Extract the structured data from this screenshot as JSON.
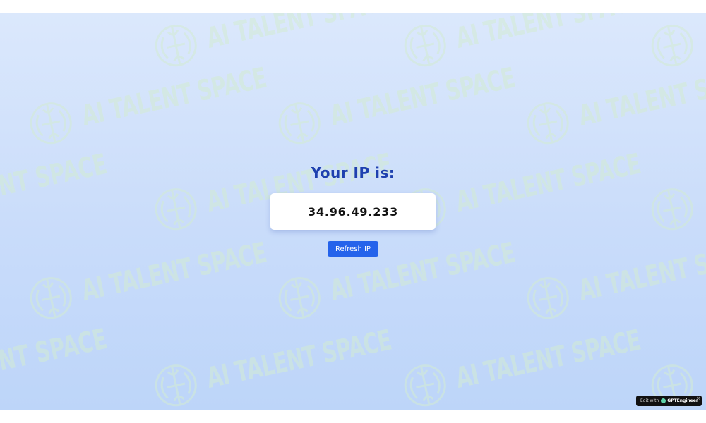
{
  "watermark": {
    "text": "AI TALENT SPACE",
    "icon": "brain-icon",
    "color": "#d3ecd3"
  },
  "main": {
    "title": "Your IP is:",
    "ip_address": "34.96.49.233",
    "refresh_label": "Refresh IP"
  },
  "badge": {
    "prefix": "Edit with",
    "brand": "GPTEngineer",
    "close_symbol": "×"
  },
  "colors": {
    "title": "#1e40af",
    "button": "#2563eb",
    "background_top": "#dbe8fc",
    "background_bottom": "#bdd5f9"
  }
}
